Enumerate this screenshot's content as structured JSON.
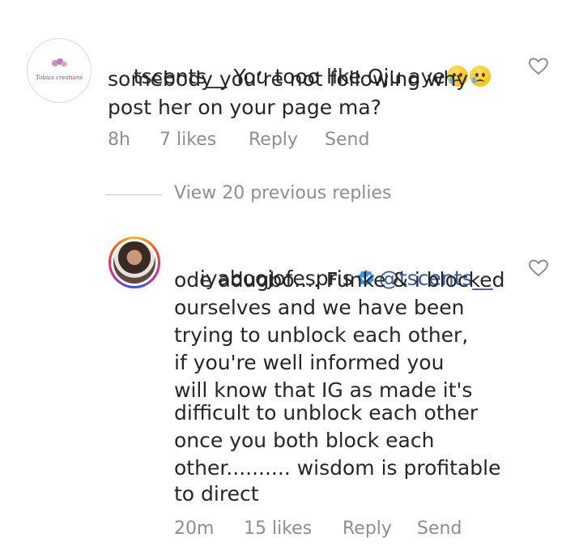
{
  "comment1": {
    "avatar_label": "Tobias creations",
    "username": "tscents__",
    "text_line1": " You tooo like Oju aye",
    "emoji": "crying-face-icon",
    "text_line2": "somebody you’re not following why",
    "text_line3": "post her on your page ma?",
    "time": "8h",
    "likes": "7 likes",
    "reply": "Reply",
    "send": "Send"
  },
  "view_replies": "View 20 previous replies",
  "comment2": {
    "username": "iyaboojofespris",
    "mention": "@tscents__",
    "lines": [
      "ode adugbo.... Funke & i blocked",
      "ourselves and we have been",
      "trying to unblock each other,",
      "if you're well informed you",
      "will know that IG as made it's",
      "difficult to unblock each other",
      "once you both block each",
      "other.......... wisdom is profitable",
      "to direct"
    ],
    "time": "20m",
    "likes": "15 likes",
    "reply": "Reply",
    "send": "Send"
  },
  "colors": {
    "meta": "#8e8e8e",
    "text": "#262626",
    "mention": "#3b5998",
    "verified": "#3897f0"
  }
}
